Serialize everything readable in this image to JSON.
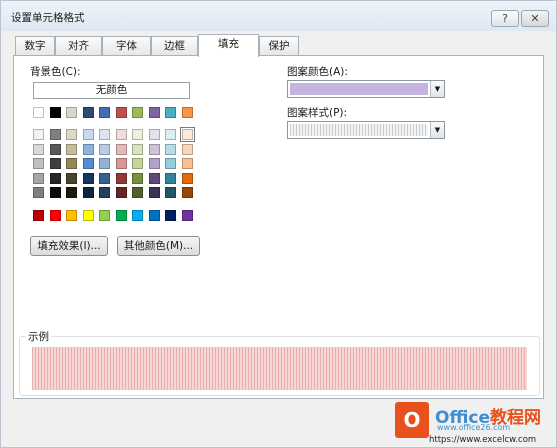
{
  "window": {
    "title": "设置单元格格式",
    "help_label": "?",
    "close_label": "✕"
  },
  "tabs": [
    {
      "label": "数字",
      "active": false
    },
    {
      "label": "对齐",
      "active": false
    },
    {
      "label": "字体",
      "active": false
    },
    {
      "label": "边框",
      "active": false
    },
    {
      "label": "填充",
      "active": true
    },
    {
      "label": "保护",
      "active": false
    }
  ],
  "fill": {
    "background_color_label": "背景色(C):",
    "no_color_label": "无颜色",
    "theme_top_row": [
      "#ffffff",
      "#000000",
      "#e7e6e6",
      "#44546a",
      "#4472c4",
      "#ed7d31",
      "#a5a5a5",
      "#ffc000",
      "#5b9bd5",
      "#70ad47"
    ],
    "theme_top_row_display": [
      "#ffffff",
      "#000000",
      "#d8d8c8",
      "#2e4a78",
      "#3f6fb4",
      "#c0504d",
      "#9bbb59",
      "#8064a2",
      "#4bacc6",
      "#f79646"
    ],
    "theme_shades": [
      [
        "#f2f2f2",
        "#7f7f7f",
        "#ddd9c3",
        "#c6d9f0",
        "#dbe5f1",
        "#f2dcdb",
        "#ebf1dd",
        "#e5e0ec",
        "#dbeef3",
        "#fdeada"
      ],
      [
        "#d8d8d8",
        "#595959",
        "#c4bd97",
        "#8db3e2",
        "#b8cce4",
        "#e5b9b7",
        "#d7e3bc",
        "#ccc1d9",
        "#b7dde8",
        "#fbd5b5"
      ],
      [
        "#bfbfbf",
        "#3f3f3f",
        "#938953",
        "#548dd4",
        "#95b3d7",
        "#d99694",
        "#c3d69b",
        "#b2a2c7",
        "#92cddc",
        "#fac08f"
      ],
      [
        "#a5a5a5",
        "#262626",
        "#494429",
        "#17365d",
        "#366092",
        "#953734",
        "#76923c",
        "#5f497a",
        "#31859b",
        "#e36c09"
      ],
      [
        "#7f7f7f",
        "#0c0c0c",
        "#1d1b10",
        "#0f243e",
        "#244061",
        "#632423",
        "#4f6128",
        "#3f3151",
        "#205867",
        "#974806"
      ]
    ],
    "selected_swatch": {
      "row": 0,
      "col": 9
    },
    "standard_colors": [
      "#c00000",
      "#ff0000",
      "#ffc000",
      "#ffff00",
      "#92d050",
      "#00b050",
      "#00b0f0",
      "#0070c0",
      "#002060",
      "#7030a0"
    ],
    "fill_effects_button": "填充效果(I)...",
    "more_colors_button": "其他颜色(M)...",
    "pattern_color_label": "图案颜色(A):",
    "pattern_color_value": "#c5b4e0",
    "pattern_style_label": "图案样式(P):",
    "sample_label": "示例",
    "sample_color": "#f4d6d4"
  },
  "watermark": {
    "logo": "O",
    "name_prefix": "Office",
    "name_suffix": "教程网",
    "url1": "www.office26.com",
    "url2": "https://www.excelcw.com"
  }
}
